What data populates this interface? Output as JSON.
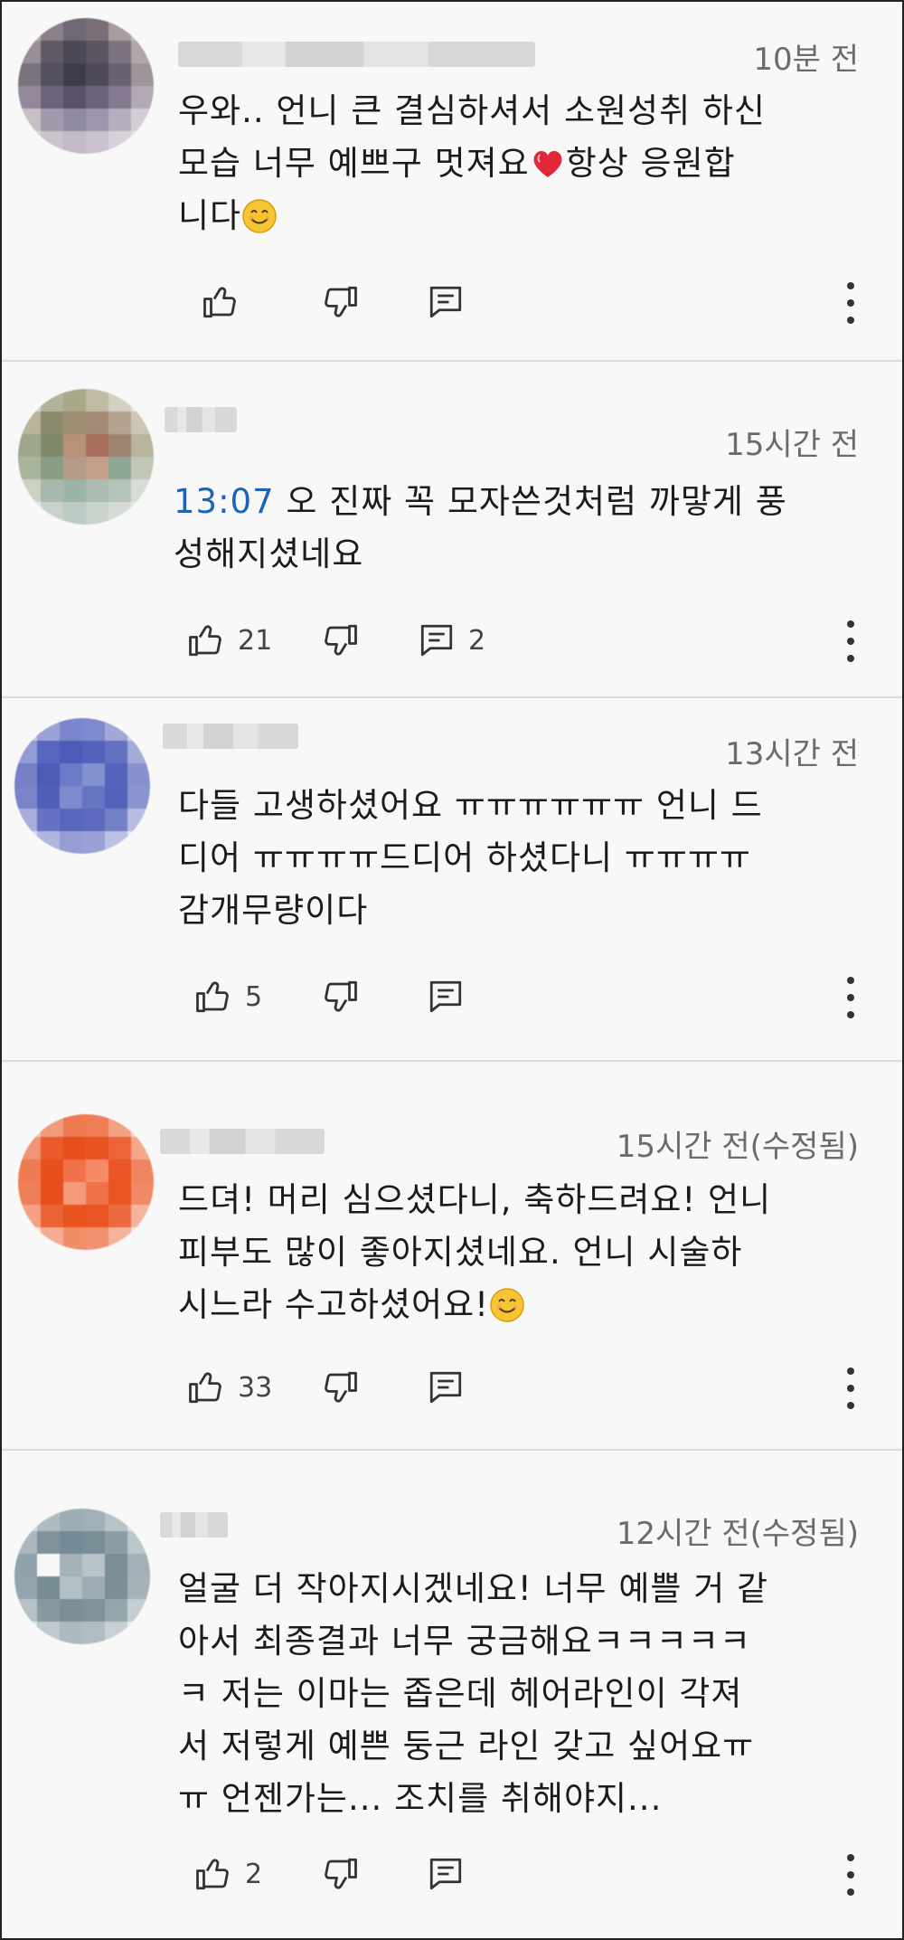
{
  "comments": [
    {
      "time": "10분 전",
      "lines": [
        "우와.. 언니 큰 결심하셔서 소원성취 하신",
        "모습 너무 예쁘구 멋져요",
        "항상 응원합",
        "니다"
      ],
      "likes": "",
      "replies": ""
    },
    {
      "time": "15시간 전",
      "timestamp_link": "13:07",
      "lines": [
        "오 진짜 꼭 모자쓴것처럼 까맣게 풍",
        "성해지셨네요"
      ],
      "likes": "21",
      "replies": "2"
    },
    {
      "time": "13시간 전",
      "lines": [
        "다들 고생하셨어요 ㅠㅠㅠㅠㅠㅠ 언니 드",
        "디어 ㅠㅠㅠㅠ드디어 하셨다니 ㅠㅠㅠㅠ",
        "감개무량이다"
      ],
      "likes": "5",
      "replies": ""
    },
    {
      "time": "15시간 전(수정됨)",
      "lines": [
        "드뎌! 머리 심으셨다니, 축하드려요! 언니",
        "피부도 많이 좋아지셨네요. 언니 시술하",
        "시느라 수고하셨어요!"
      ],
      "likes": "33",
      "replies": ""
    },
    {
      "time": "12시간 전(수정됨)",
      "lines": [
        "얼굴 더 작아지시겠네요! 너무 예쁠 거 같",
        "아서 최종결과 너무 궁금해요ㅋㅋㅋㅋㅋ",
        "ㅋ 저는 이마는 좁은데 헤어라인이 각져",
        "서 저렇게 예쁜 둥근 라인 갖고 싶어요ㅠ",
        "ㅠ 언젠가는... 조치를 취해야지..."
      ],
      "likes": "2",
      "replies": ""
    }
  ],
  "icons": {
    "like": "thumbs-up-icon",
    "dislike": "thumbs-down-icon",
    "reply": "reply-comment-icon",
    "more": "more-vertical-icon"
  },
  "colors": {
    "timestamp_link": "#1a65b8",
    "divider": "#dcdcdc",
    "background": "#f8f8f8"
  }
}
